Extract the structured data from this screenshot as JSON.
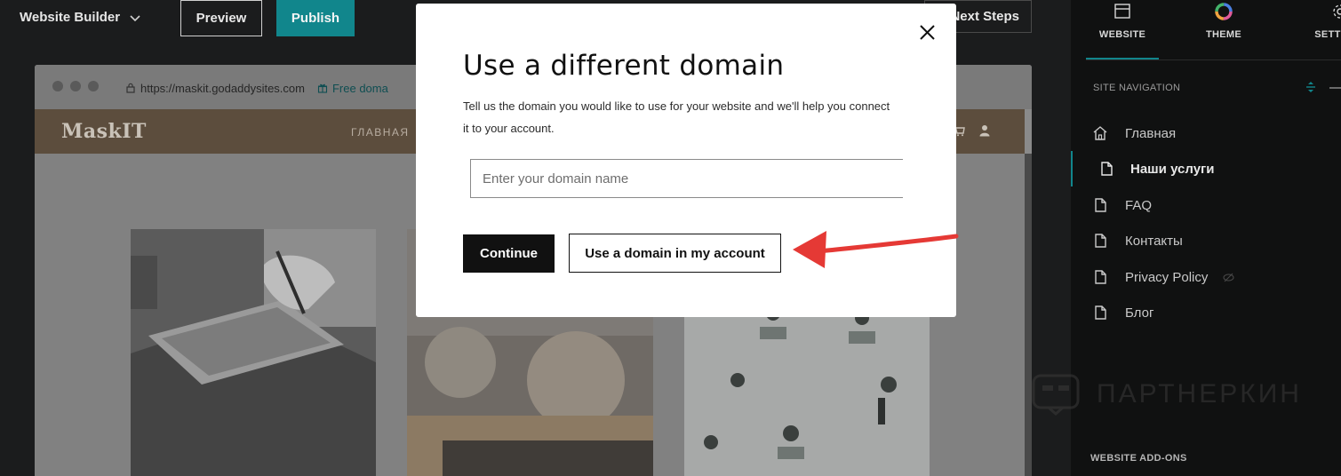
{
  "topbar": {
    "brand": "Website Builder",
    "preview_label": "Preview",
    "publish_label": "Publish",
    "next_steps_label": "Next Steps"
  },
  "browser": {
    "url": "https://maskit.godaddysites.com",
    "free_domain_label": "Free doma"
  },
  "site": {
    "logo": "MaskIT",
    "nav_first": "ГЛАВНАЯ"
  },
  "sidebar": {
    "tabs": [
      {
        "label": "WEBSITE",
        "icon": "browser-window-icon",
        "active": true
      },
      {
        "label": "THEME",
        "icon": "color-wheel-icon",
        "active": false
      },
      {
        "label": "SETTINGS",
        "icon": "gear-icon",
        "active": false
      }
    ],
    "nav_heading": "SITE NAVIGATION",
    "items": [
      {
        "label": "Главная",
        "icon": "home-icon",
        "active": false
      },
      {
        "label": "Наши услуги",
        "icon": "page-icon",
        "active": true
      },
      {
        "label": "FAQ",
        "icon": "page-icon",
        "active": false
      },
      {
        "label": "Контакты",
        "icon": "page-icon",
        "active": false
      },
      {
        "label": "Privacy Policy",
        "icon": "page-icon",
        "active": false,
        "hidden": true
      },
      {
        "label": "Блог",
        "icon": "page-icon",
        "active": false
      }
    ],
    "addons_heading": "WEBSITE ADD-ONS"
  },
  "watermark": "ПАРТНЕРКИН",
  "modal": {
    "title": "Use a different domain",
    "description": "Tell us the domain you would like to use for your website and we'll help you connect it to your account.",
    "input_placeholder": "Enter your domain name",
    "input_value": "",
    "continue_label": "Continue",
    "use_account_label": "Use a domain in my account"
  },
  "colors": {
    "accent": "#11868c",
    "arrow": "#e53935",
    "site_header": "#5c4d3d"
  }
}
